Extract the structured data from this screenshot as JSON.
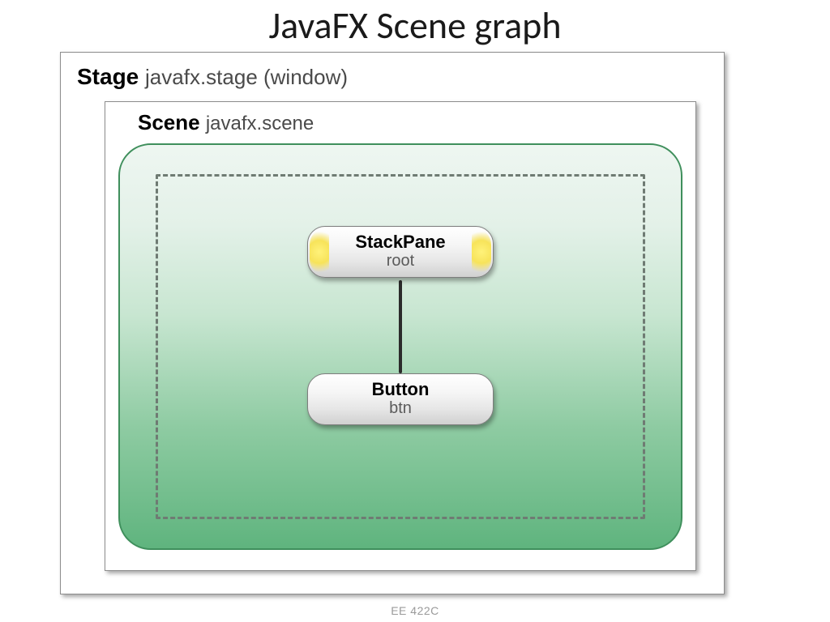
{
  "slide": {
    "title": "JavaFX Scene graph",
    "footer": "EE 422C"
  },
  "stage": {
    "label": "Stage",
    "package": "javafx.stage (window)"
  },
  "scene": {
    "label": "Scene",
    "package": "javafx.scene"
  },
  "nodes": {
    "root": {
      "class": "StackPane",
      "var": "root"
    },
    "button": {
      "class": "Button",
      "var": "btn"
    }
  }
}
